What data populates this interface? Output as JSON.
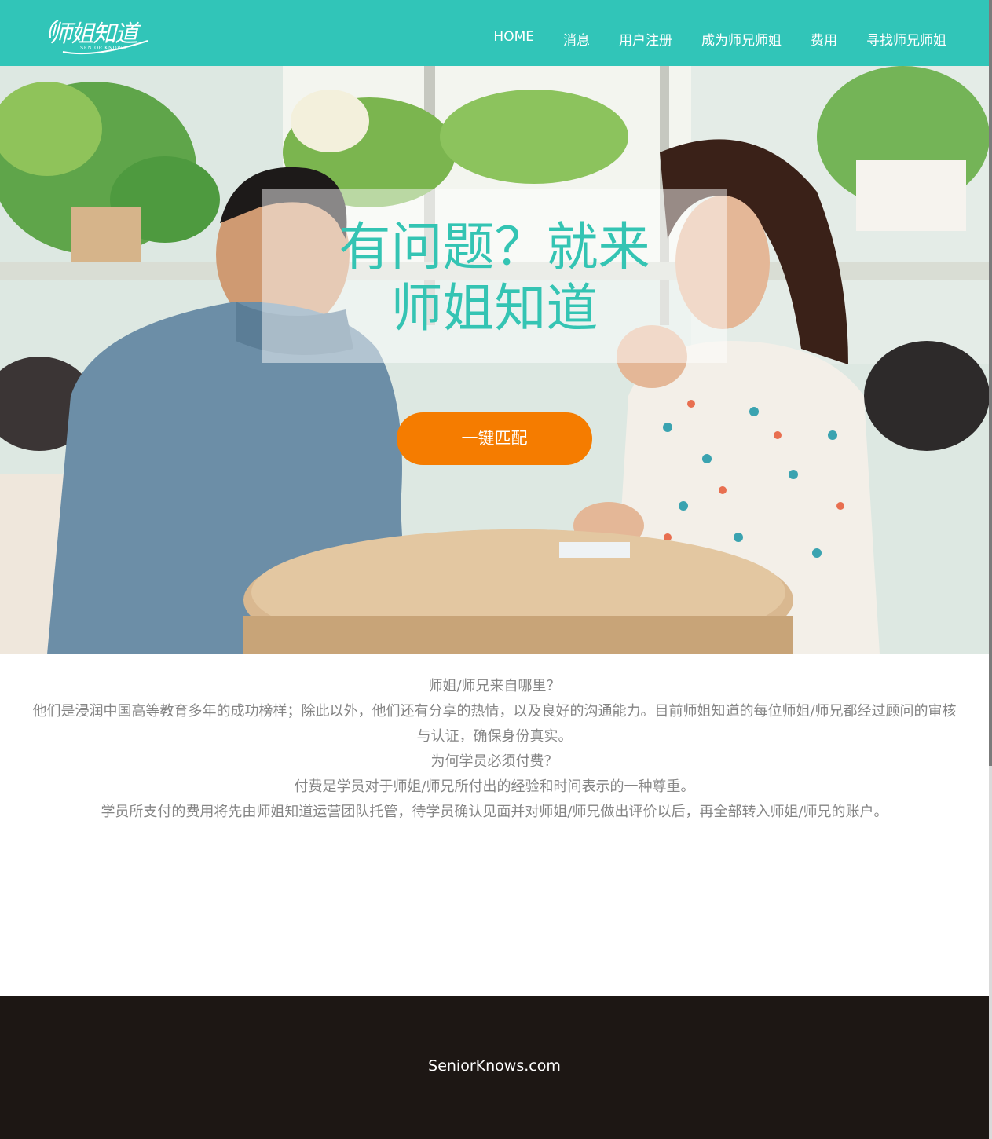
{
  "nav": {
    "logo_text": "师姐知道",
    "logo_subtext": "SENIOR KNOWS",
    "items": [
      {
        "label": "HOME"
      },
      {
        "label": "消息"
      },
      {
        "label": "用户注册"
      },
      {
        "label": "成为师兄师姐"
      },
      {
        "label": "费用"
      },
      {
        "label": "寻找师兄师姐"
      }
    ]
  },
  "hero": {
    "line1": "有问题？就来",
    "line2": "师姐知道",
    "match_button": "一键匹配"
  },
  "content": {
    "lines": [
      "师姐/师兄来自哪里？",
      "他们是浸润中国高等教育多年的成功榜样；除此以外，他们还有分享的热情，以及良好的沟通能力。目前师姐知道的每位师姐/师兄都经过顾问的审核与认证，确保身份真实。",
      "为何学员必须付费？",
      "付费是学员对于师姐/师兄所付出的经验和时间表示的一种尊重。",
      "学员所支付的费用将先由师姐知道运营团队托管，待学员确认见面并对师姐/师兄做出评价以后，再全部转入师姐/师兄的账户。"
    ]
  },
  "footer": {
    "text": "SeniorKnows.com"
  },
  "colors": {
    "brand_teal": "#31c5b8",
    "button_orange": "#f57c00",
    "footer_bg": "#1d1714",
    "body_text": "#858585"
  }
}
